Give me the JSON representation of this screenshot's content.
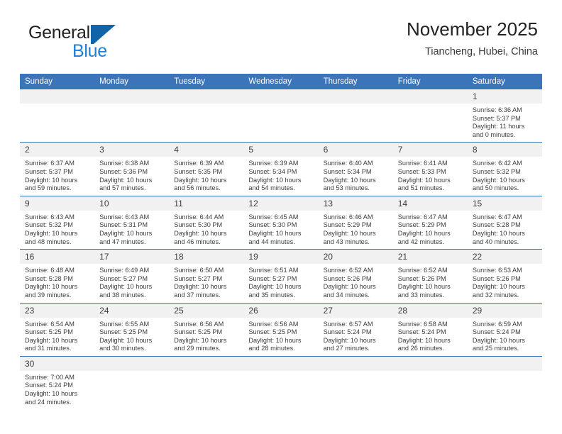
{
  "logo": {
    "word_one": "General",
    "word_two": "Blue",
    "mark": "triangle-logo-icon",
    "color_dark": "#231f20",
    "color_blue": "#1e7fd4"
  },
  "header": {
    "title": "November 2025",
    "subtitle": "Tiancheng, Hubei, China"
  },
  "theme": {
    "header_blue": "#3b74b9",
    "daynum_bg": "#f1f1f1",
    "text": "#3c3c3c"
  },
  "calendar": {
    "weekday_headers": [
      "Sunday",
      "Monday",
      "Tuesday",
      "Wednesday",
      "Thursday",
      "Friday",
      "Saturday"
    ],
    "weeks": [
      [
        {
          "day": "",
          "sunrise": "",
          "sunset": "",
          "daylight_1": "",
          "daylight_2": "",
          "empty": true
        },
        {
          "day": "",
          "sunrise": "",
          "sunset": "",
          "daylight_1": "",
          "daylight_2": "",
          "empty": true
        },
        {
          "day": "",
          "sunrise": "",
          "sunset": "",
          "daylight_1": "",
          "daylight_2": "",
          "empty": true
        },
        {
          "day": "",
          "sunrise": "",
          "sunset": "",
          "daylight_1": "",
          "daylight_2": "",
          "empty": true
        },
        {
          "day": "",
          "sunrise": "",
          "sunset": "",
          "daylight_1": "",
          "daylight_2": "",
          "empty": true
        },
        {
          "day": "",
          "sunrise": "",
          "sunset": "",
          "daylight_1": "",
          "daylight_2": "",
          "empty": true
        },
        {
          "day": "1",
          "sunrise": "Sunrise: 6:36 AM",
          "sunset": "Sunset: 5:37 PM",
          "daylight_1": "Daylight: 11 hours",
          "daylight_2": "and 0 minutes."
        }
      ],
      [
        {
          "day": "2",
          "sunrise": "Sunrise: 6:37 AM",
          "sunset": "Sunset: 5:37 PM",
          "daylight_1": "Daylight: 10 hours",
          "daylight_2": "and 59 minutes."
        },
        {
          "day": "3",
          "sunrise": "Sunrise: 6:38 AM",
          "sunset": "Sunset: 5:36 PM",
          "daylight_1": "Daylight: 10 hours",
          "daylight_2": "and 57 minutes."
        },
        {
          "day": "4",
          "sunrise": "Sunrise: 6:39 AM",
          "sunset": "Sunset: 5:35 PM",
          "daylight_1": "Daylight: 10 hours",
          "daylight_2": "and 56 minutes."
        },
        {
          "day": "5",
          "sunrise": "Sunrise: 6:39 AM",
          "sunset": "Sunset: 5:34 PM",
          "daylight_1": "Daylight: 10 hours",
          "daylight_2": "and 54 minutes."
        },
        {
          "day": "6",
          "sunrise": "Sunrise: 6:40 AM",
          "sunset": "Sunset: 5:34 PM",
          "daylight_1": "Daylight: 10 hours",
          "daylight_2": "and 53 minutes."
        },
        {
          "day": "7",
          "sunrise": "Sunrise: 6:41 AM",
          "sunset": "Sunset: 5:33 PM",
          "daylight_1": "Daylight: 10 hours",
          "daylight_2": "and 51 minutes."
        },
        {
          "day": "8",
          "sunrise": "Sunrise: 6:42 AM",
          "sunset": "Sunset: 5:32 PM",
          "daylight_1": "Daylight: 10 hours",
          "daylight_2": "and 50 minutes."
        }
      ],
      [
        {
          "day": "9",
          "sunrise": "Sunrise: 6:43 AM",
          "sunset": "Sunset: 5:32 PM",
          "daylight_1": "Daylight: 10 hours",
          "daylight_2": "and 48 minutes."
        },
        {
          "day": "10",
          "sunrise": "Sunrise: 6:43 AM",
          "sunset": "Sunset: 5:31 PM",
          "daylight_1": "Daylight: 10 hours",
          "daylight_2": "and 47 minutes."
        },
        {
          "day": "11",
          "sunrise": "Sunrise: 6:44 AM",
          "sunset": "Sunset: 5:30 PM",
          "daylight_1": "Daylight: 10 hours",
          "daylight_2": "and 46 minutes."
        },
        {
          "day": "12",
          "sunrise": "Sunrise: 6:45 AM",
          "sunset": "Sunset: 5:30 PM",
          "daylight_1": "Daylight: 10 hours",
          "daylight_2": "and 44 minutes."
        },
        {
          "day": "13",
          "sunrise": "Sunrise: 6:46 AM",
          "sunset": "Sunset: 5:29 PM",
          "daylight_1": "Daylight: 10 hours",
          "daylight_2": "and 43 minutes."
        },
        {
          "day": "14",
          "sunrise": "Sunrise: 6:47 AM",
          "sunset": "Sunset: 5:29 PM",
          "daylight_1": "Daylight: 10 hours",
          "daylight_2": "and 42 minutes."
        },
        {
          "day": "15",
          "sunrise": "Sunrise: 6:47 AM",
          "sunset": "Sunset: 5:28 PM",
          "daylight_1": "Daylight: 10 hours",
          "daylight_2": "and 40 minutes."
        }
      ],
      [
        {
          "day": "16",
          "sunrise": "Sunrise: 6:48 AM",
          "sunset": "Sunset: 5:28 PM",
          "daylight_1": "Daylight: 10 hours",
          "daylight_2": "and 39 minutes."
        },
        {
          "day": "17",
          "sunrise": "Sunrise: 6:49 AM",
          "sunset": "Sunset: 5:27 PM",
          "daylight_1": "Daylight: 10 hours",
          "daylight_2": "and 38 minutes."
        },
        {
          "day": "18",
          "sunrise": "Sunrise: 6:50 AM",
          "sunset": "Sunset: 5:27 PM",
          "daylight_1": "Daylight: 10 hours",
          "daylight_2": "and 37 minutes."
        },
        {
          "day": "19",
          "sunrise": "Sunrise: 6:51 AM",
          "sunset": "Sunset: 5:27 PM",
          "daylight_1": "Daylight: 10 hours",
          "daylight_2": "and 35 minutes."
        },
        {
          "day": "20",
          "sunrise": "Sunrise: 6:52 AM",
          "sunset": "Sunset: 5:26 PM",
          "daylight_1": "Daylight: 10 hours",
          "daylight_2": "and 34 minutes."
        },
        {
          "day": "21",
          "sunrise": "Sunrise: 6:52 AM",
          "sunset": "Sunset: 5:26 PM",
          "daylight_1": "Daylight: 10 hours",
          "daylight_2": "and 33 minutes."
        },
        {
          "day": "22",
          "sunrise": "Sunrise: 6:53 AM",
          "sunset": "Sunset: 5:26 PM",
          "daylight_1": "Daylight: 10 hours",
          "daylight_2": "and 32 minutes."
        }
      ],
      [
        {
          "day": "23",
          "sunrise": "Sunrise: 6:54 AM",
          "sunset": "Sunset: 5:25 PM",
          "daylight_1": "Daylight: 10 hours",
          "daylight_2": "and 31 minutes."
        },
        {
          "day": "24",
          "sunrise": "Sunrise: 6:55 AM",
          "sunset": "Sunset: 5:25 PM",
          "daylight_1": "Daylight: 10 hours",
          "daylight_2": "and 30 minutes."
        },
        {
          "day": "25",
          "sunrise": "Sunrise: 6:56 AM",
          "sunset": "Sunset: 5:25 PM",
          "daylight_1": "Daylight: 10 hours",
          "daylight_2": "and 29 minutes."
        },
        {
          "day": "26",
          "sunrise": "Sunrise: 6:56 AM",
          "sunset": "Sunset: 5:25 PM",
          "daylight_1": "Daylight: 10 hours",
          "daylight_2": "and 28 minutes."
        },
        {
          "day": "27",
          "sunrise": "Sunrise: 6:57 AM",
          "sunset": "Sunset: 5:24 PM",
          "daylight_1": "Daylight: 10 hours",
          "daylight_2": "and 27 minutes."
        },
        {
          "day": "28",
          "sunrise": "Sunrise: 6:58 AM",
          "sunset": "Sunset: 5:24 PM",
          "daylight_1": "Daylight: 10 hours",
          "daylight_2": "and 26 minutes."
        },
        {
          "day": "29",
          "sunrise": "Sunrise: 6:59 AM",
          "sunset": "Sunset: 5:24 PM",
          "daylight_1": "Daylight: 10 hours",
          "daylight_2": "and 25 minutes."
        }
      ],
      [
        {
          "day": "30",
          "sunrise": "Sunrise: 7:00 AM",
          "sunset": "Sunset: 5:24 PM",
          "daylight_1": "Daylight: 10 hours",
          "daylight_2": "and 24 minutes."
        },
        {
          "day": "",
          "sunrise": "",
          "sunset": "",
          "daylight_1": "",
          "daylight_2": "",
          "empty": true
        },
        {
          "day": "",
          "sunrise": "",
          "sunset": "",
          "daylight_1": "",
          "daylight_2": "",
          "empty": true
        },
        {
          "day": "",
          "sunrise": "",
          "sunset": "",
          "daylight_1": "",
          "daylight_2": "",
          "empty": true
        },
        {
          "day": "",
          "sunrise": "",
          "sunset": "",
          "daylight_1": "",
          "daylight_2": "",
          "empty": true
        },
        {
          "day": "",
          "sunrise": "",
          "sunset": "",
          "daylight_1": "",
          "daylight_2": "",
          "empty": true
        },
        {
          "day": "",
          "sunrise": "",
          "sunset": "",
          "daylight_1": "",
          "daylight_2": "",
          "empty": true
        }
      ]
    ]
  }
}
